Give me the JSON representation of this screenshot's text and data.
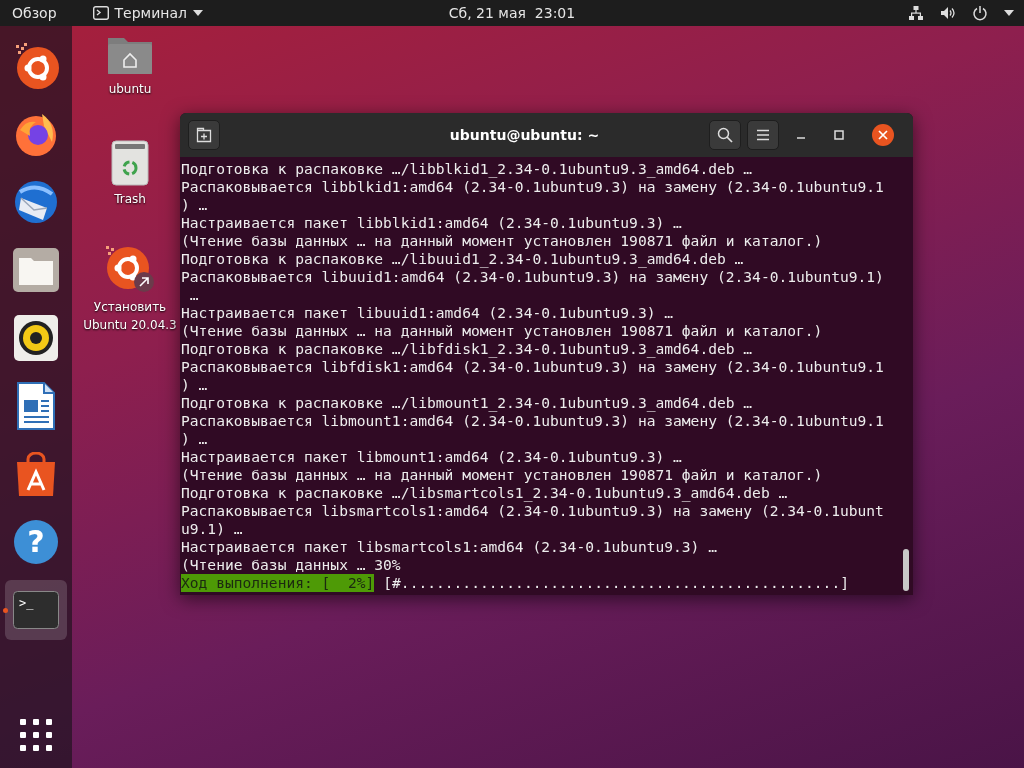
{
  "top_bar": {
    "activities": "Обзор",
    "app_menu": "Терминал",
    "clock": "Сб, 21 мая  23:01"
  },
  "dock": {
    "items": [
      {
        "kind": "ubuntu",
        "running": false,
        "selected": false
      },
      {
        "kind": "firefox",
        "running": false,
        "selected": false
      },
      {
        "kind": "thunderbird",
        "running": false,
        "selected": false
      },
      {
        "kind": "files",
        "running": false,
        "selected": false
      },
      {
        "kind": "rhythmbox",
        "running": false,
        "selected": false
      },
      {
        "kind": "writer",
        "running": false,
        "selected": false
      },
      {
        "kind": "store",
        "running": false,
        "selected": false
      },
      {
        "kind": "help",
        "running": false,
        "selected": false,
        "glyph": "?"
      },
      {
        "kind": "terminal",
        "running": true,
        "selected": true,
        "glyph": ">_"
      }
    ]
  },
  "desktop_icons": [
    {
      "kind": "home",
      "label": "ubuntu"
    },
    {
      "kind": "trash",
      "label": "Trash"
    },
    {
      "kind": "installer",
      "label": "Установить Ubuntu 20.04.3"
    }
  ],
  "terminal": {
    "title": "ubuntu@ubuntu: ~",
    "lines": [
      "Подготовка к распаковке …/libblkid1_2.34-0.1ubuntu9.3_amd64.deb …",
      "Распаковывается libblkid1:amd64 (2.34-0.1ubuntu9.3) на замену (2.34-0.1ubuntu9.1",
      ") …",
      "Настраивается пакет libblkid1:amd64 (2.34-0.1ubuntu9.3) …",
      "(Чтение базы данных … на данный момент установлен 190871 файл и каталог.)",
      "Подготовка к распаковке …/libuuid1_2.34-0.1ubuntu9.3_amd64.deb …",
      "Распаковывается libuuid1:amd64 (2.34-0.1ubuntu9.3) на замену (2.34-0.1ubuntu9.1)",
      " …",
      "Настраивается пакет libuuid1:amd64 (2.34-0.1ubuntu9.3) …",
      "(Чтение базы данных … на данный момент установлен 190871 файл и каталог.)",
      "Подготовка к распаковке …/libfdisk1_2.34-0.1ubuntu9.3_amd64.deb …",
      "Распаковывается libfdisk1:amd64 (2.34-0.1ubuntu9.3) на замену (2.34-0.1ubuntu9.1",
      ") …",
      "Подготовка к распаковке …/libmount1_2.34-0.1ubuntu9.3_amd64.deb …",
      "Распаковывается libmount1:amd64 (2.34-0.1ubuntu9.3) на замену (2.34-0.1ubuntu9.1",
      ") …",
      "Настраивается пакет libmount1:amd64 (2.34-0.1ubuntu9.3) …",
      "(Чтение базы данных … на данный момент установлен 190871 файл и каталог.)",
      "Подготовка к распаковке …/libsmartcols1_2.34-0.1ubuntu9.3_amd64.deb …",
      "Распаковывается libsmartcols1:amd64 (2.34-0.1ubuntu9.3) на замену (2.34-0.1ubunt",
      "u9.1) …",
      "Настраивается пакет libsmartcols1:amd64 (2.34-0.1ubuntu9.3) …",
      "(Чтение базы данных … 30%"
    ],
    "progress": {
      "label": "Ход выполнения: [  2%]",
      "bar": "[#..................................................]"
    }
  }
}
